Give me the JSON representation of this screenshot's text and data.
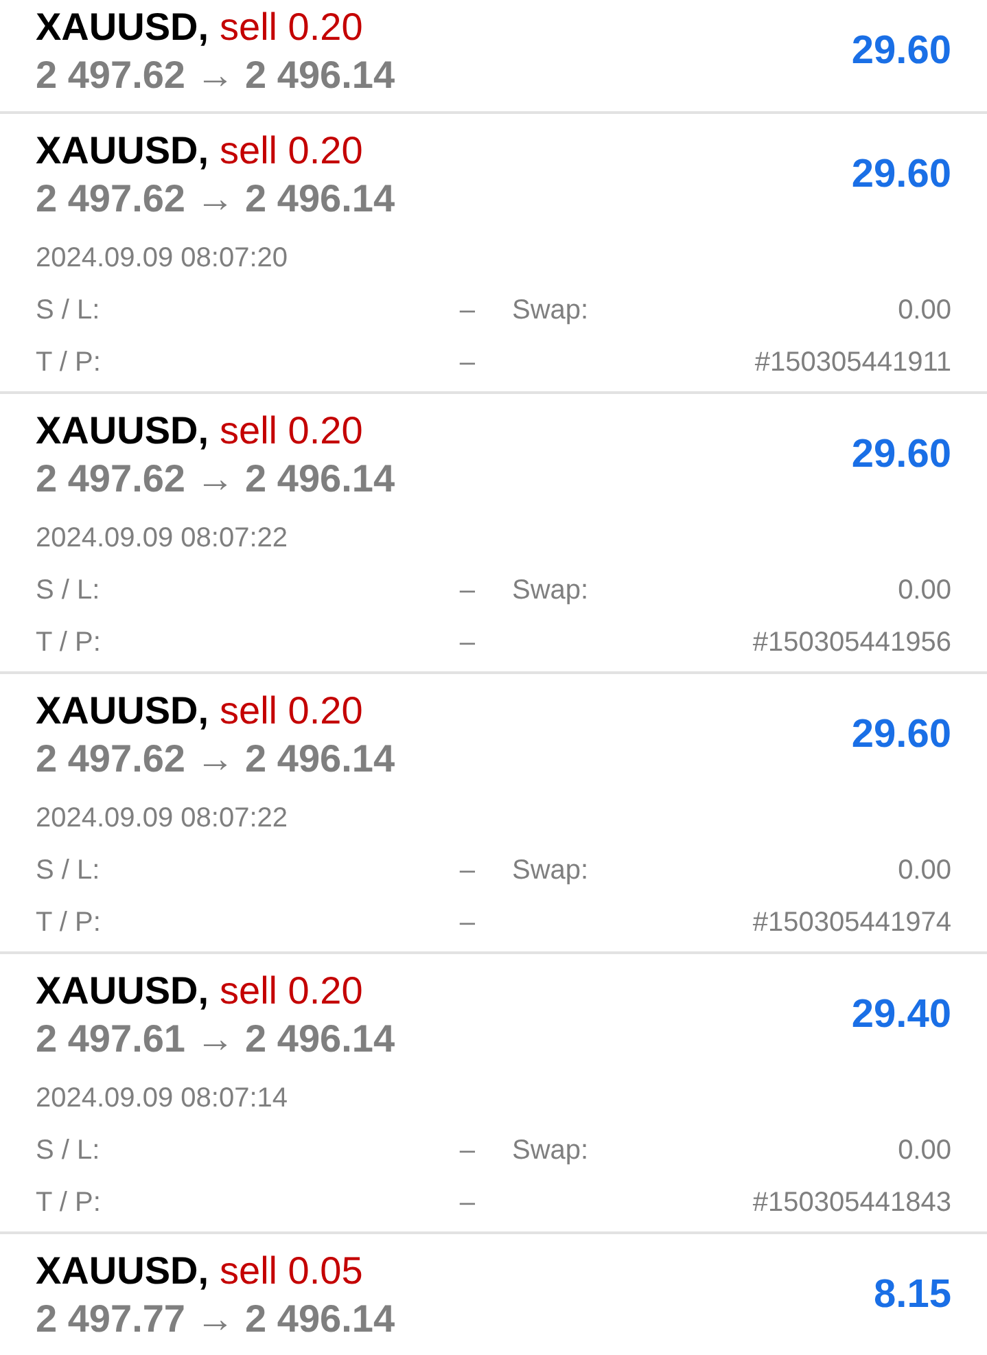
{
  "trades": [
    {
      "symbol": "XAUUSD,",
      "order": "sell 0.20",
      "prices": "2 497.62 → 2 496.14",
      "profit": "29.60",
      "expanded": false
    },
    {
      "symbol": "XAUUSD,",
      "order": "sell 0.20",
      "prices": "2 497.62 → 2 496.14",
      "profit": "29.60",
      "expanded": true,
      "time": "2024.09.09 08:07:20",
      "sl_label": "S / L:",
      "sl": "–",
      "swap_label": "Swap:",
      "swap": "0.00",
      "tp_label": "T / P:",
      "tp": "–",
      "ticket": "#150305441911"
    },
    {
      "symbol": "XAUUSD,",
      "order": "sell 0.20",
      "prices": "2 497.62 → 2 496.14",
      "profit": "29.60",
      "expanded": true,
      "time": "2024.09.09 08:07:22",
      "sl_label": "S / L:",
      "sl": "–",
      "swap_label": "Swap:",
      "swap": "0.00",
      "tp_label": "T / P:",
      "tp": "–",
      "ticket": "#150305441956"
    },
    {
      "symbol": "XAUUSD,",
      "order": "sell 0.20",
      "prices": "2 497.62 → 2 496.14",
      "profit": "29.60",
      "expanded": true,
      "time": "2024.09.09 08:07:22",
      "sl_label": "S / L:",
      "sl": "–",
      "swap_label": "Swap:",
      "swap": "0.00",
      "tp_label": "T / P:",
      "tp": "–",
      "ticket": "#150305441974"
    },
    {
      "symbol": "XAUUSD,",
      "order": "sell 0.20",
      "prices": "2 497.61 → 2 496.14",
      "profit": "29.40",
      "expanded": true,
      "time": "2024.09.09 08:07:14",
      "sl_label": "S / L:",
      "sl": "–",
      "swap_label": "Swap:",
      "swap": "0.00",
      "tp_label": "T / P:",
      "tp": "–",
      "ticket": "#150305441843"
    },
    {
      "symbol": "XAUUSD,",
      "order": "sell 0.05",
      "prices": "2 497.77 → 2 496.14",
      "profit": "8.15",
      "expanded": false
    }
  ]
}
